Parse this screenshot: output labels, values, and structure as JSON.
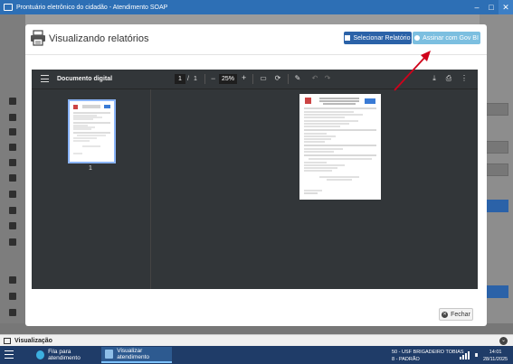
{
  "window": {
    "title": "Prontuário eletrônico do cidadão - Atendimento SOAP",
    "controls": [
      "minimize-icon",
      "maximize-icon",
      "close-icon"
    ]
  },
  "modal": {
    "title": "Visualizando relatórios",
    "select_report_label": "Selecionar Relatório",
    "sign_label": "Assinar com Gov BI",
    "close_label": "Fechar"
  },
  "viewer": {
    "doc_title": "Documento digital",
    "current_page": "1",
    "page_separator": "/",
    "total_pages": "1",
    "zoom": "25%",
    "zoom_out_label": "−",
    "zoom_in_label": "+",
    "thumbnail_page_number": "1",
    "toolbar_icons": [
      "fit-page-icon",
      "rotate-icon",
      "annotate-icon",
      "undo-icon",
      "redo-icon",
      "download-icon",
      "print-icon",
      "more-options-icon"
    ]
  },
  "visualization_bar": {
    "title": "Visualização"
  },
  "taskbar": {
    "tasks": [
      {
        "label": "Fila para atendimento"
      },
      {
        "label": "Visualizar atendimento"
      }
    ],
    "unit_line1": "50 - USF BRIGADEIRO TOBIAS",
    "unit_line2": "8 - PADRÃO",
    "time": "14:01",
    "date": "28/11/2025"
  },
  "colors": {
    "titlebar": "#2d6fb5",
    "primary_button": "#2b62a8",
    "sign_button": "#7cbfe0",
    "viewer_bg": "#323639",
    "taskbar": "#1f3c68",
    "annotation_arrow": "#d0021b"
  }
}
